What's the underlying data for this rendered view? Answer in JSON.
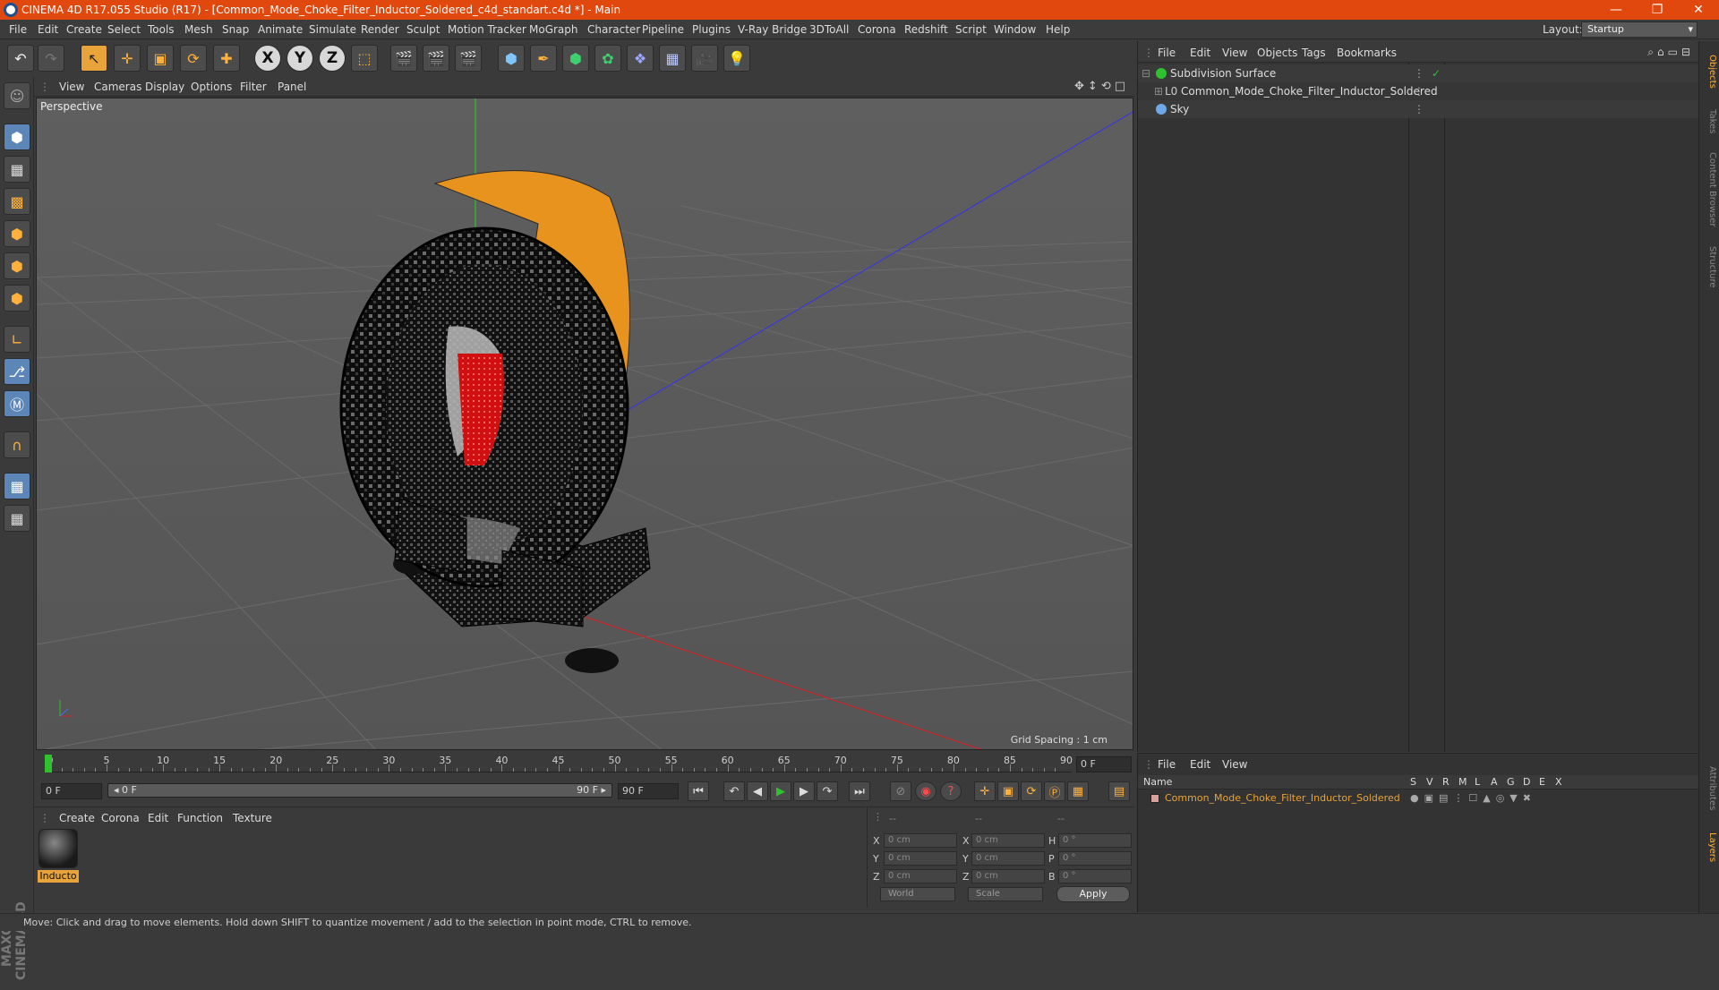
{
  "titlebar": {
    "title": "CINEMA 4D R17.055 Studio (R17) - [Common_Mode_Choke_Filter_Inductor_Soldered_c4d_standart.c4d *] - Main",
    "minimize": "—",
    "restore": "❐",
    "close": "✕"
  },
  "menubar": {
    "items": [
      "File",
      "Edit",
      "Create",
      "Select",
      "Tools",
      "Mesh",
      "Snap",
      "Animate",
      "Simulate",
      "Render",
      "Sculpt",
      "Motion Tracker",
      "MoGraph",
      "Character",
      "Pipeline",
      "Plugins",
      "V-Ray Bridge",
      "3DToAll",
      "Corona",
      "Redshift",
      "Script",
      "Window",
      "Help"
    ],
    "layout_label": "Layout:",
    "layout_value": "Startup"
  },
  "toolbar": {
    "undo": "↶",
    "redo": "↷",
    "select": "↖",
    "move": "✛",
    "scale": "▣",
    "rotate": "⟳",
    "transform": "✚",
    "axis_x": "X",
    "axis_y": "Y",
    "axis_z": "Z",
    "coord": "⬚"
  },
  "viewport": {
    "menu": [
      "View",
      "Cameras",
      "Display",
      "Options",
      "Filter",
      "Panel"
    ],
    "nav_icons": "✥↕⟲□",
    "label": "Perspective",
    "grid_spacing": "Grid Spacing : 1 cm"
  },
  "timeline": {
    "ticks": [
      "0",
      "5",
      "10",
      "15",
      "20",
      "25",
      "30",
      "35",
      "40",
      "45",
      "50",
      "55",
      "60",
      "65",
      "70",
      "75",
      "80",
      "85",
      "90"
    ],
    "end_frame": "0 F"
  },
  "transport": {
    "start_field": "0 F",
    "slider_left": "◂ 0 F",
    "slider_right": "90 F ▸",
    "end_field": "90 F"
  },
  "material": {
    "menu": [
      "Create",
      "Corona",
      "Edit",
      "Function",
      "Texture"
    ],
    "name": "Inducto"
  },
  "coordinates": {
    "header": [
      "--",
      "--",
      "--"
    ],
    "rows": [
      {
        "a": "X",
        "av": "0 cm",
        "b": "X",
        "bv": "0 cm",
        "c": "H",
        "cv": "0 °"
      },
      {
        "a": "Y",
        "av": "0 cm",
        "b": "Y",
        "bv": "0 cm",
        "c": "P",
        "cv": "0 °"
      },
      {
        "a": "Z",
        "av": "0 cm",
        "b": "Z",
        "bv": "0 cm",
        "c": "B",
        "cv": "0 °"
      }
    ],
    "mode": "World",
    "size_mode": "Scale",
    "apply": "Apply"
  },
  "objects": {
    "menu": [
      "File",
      "Edit",
      "View",
      "Objects",
      "Tags",
      "Bookmarks"
    ],
    "toolicons": "⌕⌂▭⊟",
    "items": [
      {
        "name": "Subdivision Surface",
        "color": "#2ec22e",
        "check": "✓"
      },
      {
        "name": "Common_Mode_Choke_Filter_Inductor_Soldered",
        "color": "#cfcfcf",
        "check": ""
      },
      {
        "name": "Sky",
        "color": "#6fa8e8",
        "check": ""
      }
    ]
  },
  "layers": {
    "menu": [
      "File",
      "Edit",
      "View"
    ],
    "headers": [
      "Name",
      "S",
      "V",
      "R",
      "M",
      "L",
      "A",
      "G",
      "D",
      "E",
      "X"
    ],
    "row_name": "Common_Mode_Choke_Filter_Inductor_Soldered",
    "row_color": "#e8a33a"
  },
  "sidetabs": [
    "Objects",
    "Takes",
    "Content Browser",
    "Structure",
    "Attributes",
    "Layers"
  ],
  "status": "Move: Click and drag to move elements. Hold down SHIFT to quantize movement / add to the selection in point mode, CTRL to remove.",
  "brand": "MAXON CINEMA 4D"
}
